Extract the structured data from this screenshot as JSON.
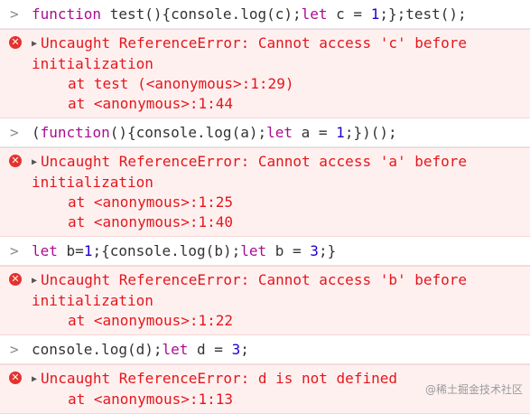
{
  "entries": [
    {
      "input": [
        {
          "t": "function",
          "k": "kw"
        },
        {
          "t": " test(){console.log(c);",
          "k": "plain"
        },
        {
          "t": "let",
          "k": "kw"
        },
        {
          "t": " c = ",
          "k": "plain"
        },
        {
          "t": "1",
          "k": "num"
        },
        {
          "t": ";};test();",
          "k": "plain"
        }
      ],
      "error": {
        "message": "Uncaught ReferenceError: Cannot access 'c' before initialization",
        "stack": [
          "at test (<anonymous>:1:29)",
          "at <anonymous>:1:44"
        ]
      }
    },
    {
      "input": [
        {
          "t": "(",
          "k": "plain"
        },
        {
          "t": "function",
          "k": "kw"
        },
        {
          "t": "(){console.log(a);",
          "k": "plain"
        },
        {
          "t": "let",
          "k": "kw"
        },
        {
          "t": " a = ",
          "k": "plain"
        },
        {
          "t": "1",
          "k": "num"
        },
        {
          "t": ";})();",
          "k": "plain"
        }
      ],
      "error": {
        "message": "Uncaught ReferenceError: Cannot access 'a' before initialization",
        "stack": [
          "at <anonymous>:1:25",
          "at <anonymous>:1:40"
        ]
      }
    },
    {
      "input": [
        {
          "t": "let",
          "k": "kw"
        },
        {
          "t": " b=",
          "k": "plain"
        },
        {
          "t": "1",
          "k": "num"
        },
        {
          "t": ";{console.log(b);",
          "k": "plain"
        },
        {
          "t": "let",
          "k": "kw"
        },
        {
          "t": " b = ",
          "k": "plain"
        },
        {
          "t": "3",
          "k": "num"
        },
        {
          "t": ";}",
          "k": "plain"
        }
      ],
      "error": {
        "message": "Uncaught ReferenceError: Cannot access 'b' before initialization",
        "stack": [
          "at <anonymous>:1:22"
        ]
      }
    },
    {
      "input": [
        {
          "t": "console.log(d);",
          "k": "plain"
        },
        {
          "t": "let",
          "k": "kw"
        },
        {
          "t": " d = ",
          "k": "plain"
        },
        {
          "t": "3",
          "k": "num"
        },
        {
          "t": ";",
          "k": "plain"
        }
      ],
      "error": {
        "message": "Uncaught ReferenceError: d is not defined",
        "stack": [
          "at <anonymous>:1:13"
        ]
      }
    }
  ],
  "icons": {
    "prompt": "chevron-right-icon",
    "error": "error-circle-icon",
    "expand": "triangle-right-icon"
  },
  "glyphs": {
    "prompt": ">",
    "error": "✕",
    "expand": "▶"
  },
  "colors": {
    "keyword": "#aa0d91",
    "number": "#1c00cf",
    "error_text": "#e4171c",
    "error_bg": "#fff0f0"
  },
  "watermark": "@稀土掘金技术社区"
}
